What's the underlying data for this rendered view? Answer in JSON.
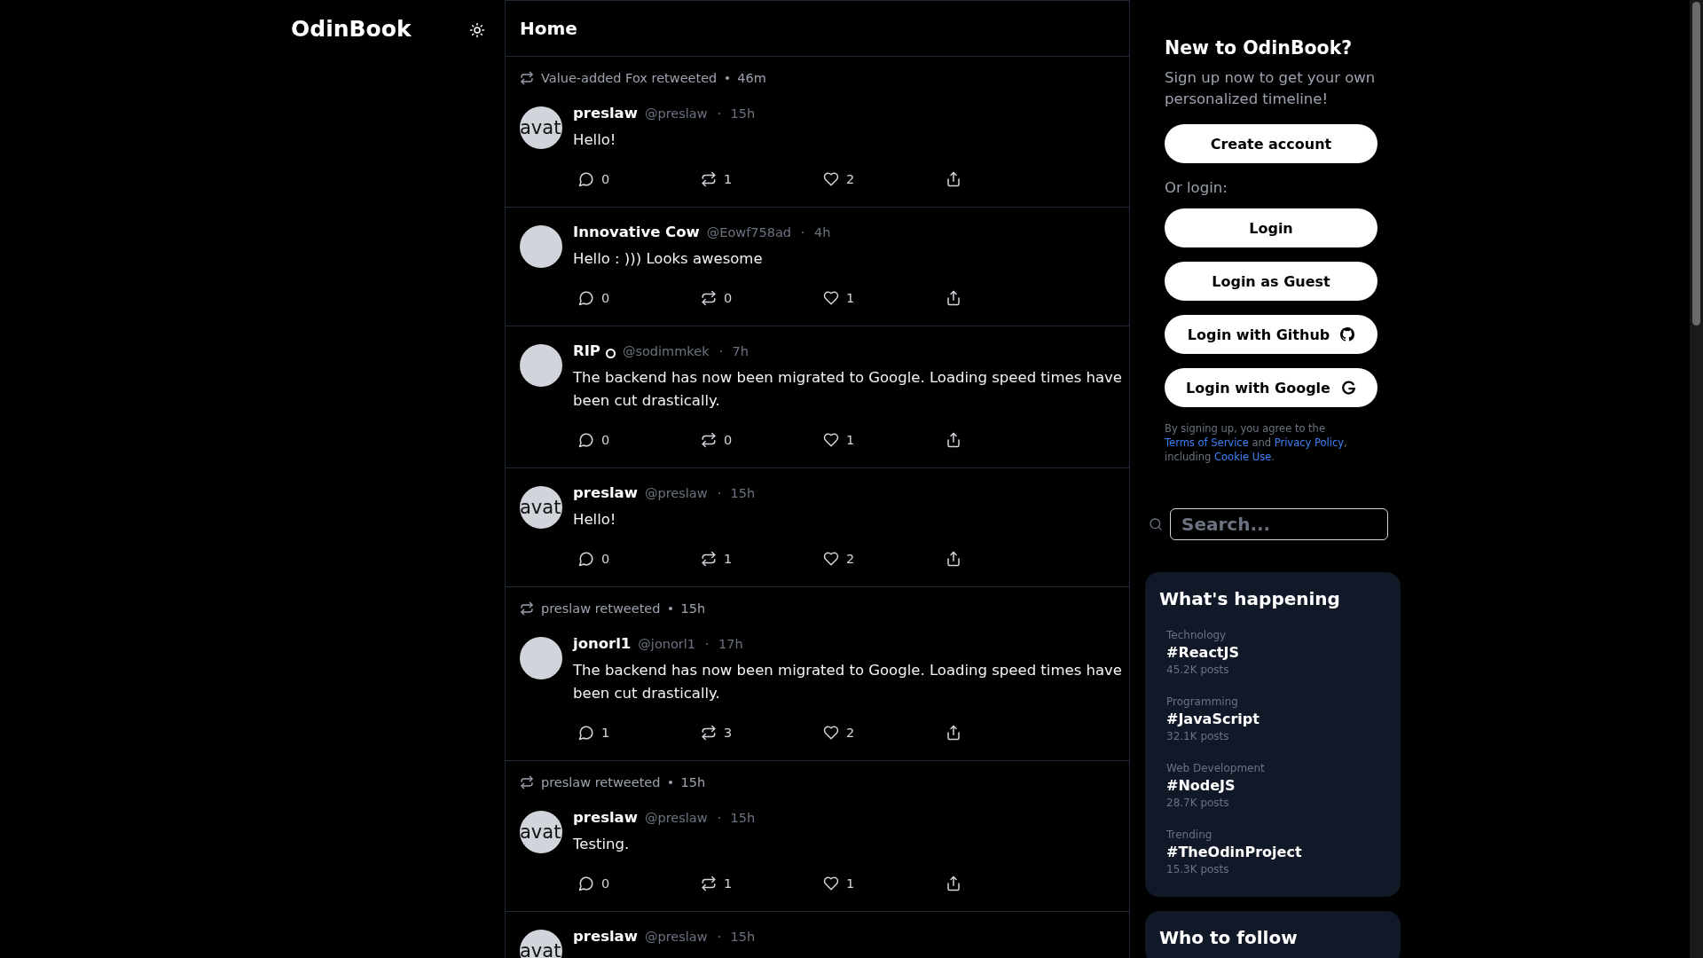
{
  "logo": "OdinBook",
  "feed": {
    "title": "Home",
    "posts": [
      {
        "retweet": {
          "by": "Value-added Fox retweeted",
          "time": "46m"
        },
        "avatar_alt": "avat",
        "author": {
          "name": "preslaw",
          "handle": "@preslaw",
          "time": "15h",
          "badge": false
        },
        "text": "Hello!",
        "stats": {
          "replies": "0",
          "retweets": "1",
          "likes": "2"
        }
      },
      {
        "author": {
          "name": "Innovative Cow",
          "handle": "@Eowf758ad",
          "time": "4h",
          "badge": false
        },
        "text": "Hello : ))) Looks awesome",
        "stats": {
          "replies": "0",
          "retweets": "0",
          "likes": "1"
        }
      },
      {
        "author": {
          "name": "RIP",
          "handle": "@sodimmkek",
          "time": "7h",
          "badge": true
        },
        "text": "The backend has now been migrated to Google. Loading speed times have been cut drastically.",
        "stats": {
          "replies": "0",
          "retweets": "0",
          "likes": "1"
        }
      },
      {
        "avatar_alt": "avat",
        "author": {
          "name": "preslaw",
          "handle": "@preslaw",
          "time": "15h",
          "badge": false
        },
        "text": "Hello!",
        "stats": {
          "replies": "0",
          "retweets": "1",
          "likes": "2"
        }
      },
      {
        "retweet": {
          "by": "preslaw retweeted",
          "time": "15h"
        },
        "author": {
          "name": "jonorl1",
          "handle": "@jonorl1",
          "time": "17h",
          "badge": false
        },
        "text": "The backend has now been migrated to Google. Loading speed times have been cut drastically.",
        "stats": {
          "replies": "1",
          "retweets": "3",
          "likes": "2"
        }
      },
      {
        "retweet": {
          "by": "preslaw retweeted",
          "time": "15h"
        },
        "avatar_alt": "avat",
        "author": {
          "name": "preslaw",
          "handle": "@preslaw",
          "time": "15h",
          "badge": false
        },
        "text": "Testing.",
        "stats": {
          "replies": "0",
          "retweets": "1",
          "likes": "1"
        }
      },
      {
        "avatar_alt": "avat",
        "author": {
          "name": "preslaw",
          "handle": "@preslaw",
          "time": "15h",
          "badge": false
        }
      }
    ]
  },
  "signup": {
    "title": "New to OdinBook?",
    "subtitle": "Sign up now to get your own personalized timeline!",
    "create": "Create account",
    "or": "Or login:",
    "buttons": [
      {
        "label": "Login",
        "kind": "plain"
      },
      {
        "label": "Login as Guest",
        "kind": "plain"
      },
      {
        "label": "Login with Github",
        "kind": "github"
      },
      {
        "label": "Login with Google",
        "kind": "google"
      }
    ],
    "terms": [
      {
        "kind": "text",
        "text": "By signing up, you agree to the "
      },
      {
        "kind": "link",
        "text": "Terms of Service"
      },
      {
        "kind": "text",
        "text": " and "
      },
      {
        "kind": "link",
        "text": "Privacy Policy"
      },
      {
        "kind": "text",
        "text": ", including "
      },
      {
        "kind": "link",
        "text": "Cookie Use"
      },
      {
        "kind": "text",
        "text": "."
      }
    ]
  },
  "search": {
    "placeholder": "Search..."
  },
  "trends": {
    "title": "What's happening",
    "items": [
      {
        "category": "Technology",
        "tag": "#ReactJS",
        "posts": "45.2K posts"
      },
      {
        "category": "Programming",
        "tag": "#JavaScript",
        "posts": "32.1K posts"
      },
      {
        "category": "Web Development",
        "tag": "#NodeJS",
        "posts": "28.7K posts"
      },
      {
        "category": "Trending",
        "tag": "#TheOdinProject",
        "posts": "15.3K posts"
      }
    ]
  },
  "follow": {
    "title": "Who to follow"
  }
}
